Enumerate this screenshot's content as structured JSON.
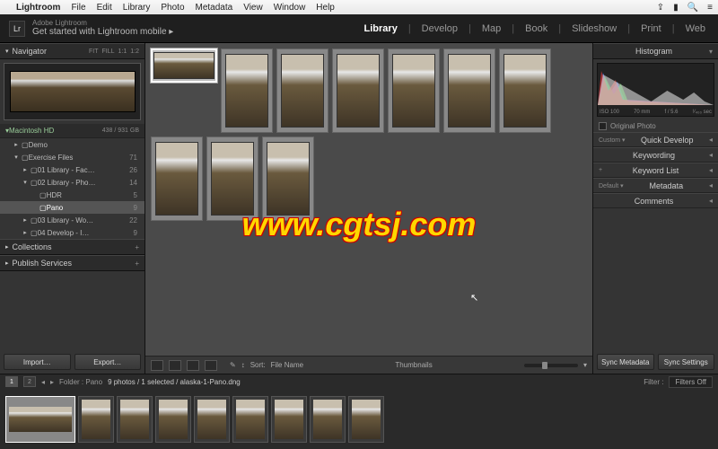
{
  "menubar": {
    "app": "Lightroom",
    "items": [
      "File",
      "Edit",
      "Library",
      "Photo",
      "Metadata",
      "View",
      "Window",
      "Help"
    ]
  },
  "brand": {
    "sub": "Adobe Lightroom",
    "title": "Get started with Lightroom mobile ▸"
  },
  "modules": [
    "Library",
    "Develop",
    "Map",
    "Book",
    "Slideshow",
    "Print",
    "Web"
  ],
  "active_module": "Library",
  "navigator": {
    "label": "Navigator",
    "opts": [
      "FIT",
      "FILL",
      "1:1",
      "1:2"
    ]
  },
  "volume": {
    "name": "Macintosh HD",
    "stat": "438 / 931 GB"
  },
  "tree": [
    {
      "ind": 1,
      "icon": "▸",
      "name": "Demo",
      "ct": ""
    },
    {
      "ind": 1,
      "icon": "▾",
      "name": "Exercise Files",
      "ct": "71"
    },
    {
      "ind": 2,
      "icon": "▸",
      "name": "01 Library - Fac…",
      "ct": "26"
    },
    {
      "ind": 2,
      "icon": "▾",
      "name": "02 Library - Pho…",
      "ct": "14"
    },
    {
      "ind": 3,
      "icon": "",
      "name": "HDR",
      "ct": "5"
    },
    {
      "ind": 3,
      "icon": "",
      "name": "Pano",
      "ct": "9",
      "sel": true
    },
    {
      "ind": 2,
      "icon": "▸",
      "name": "03 Library - Wo…",
      "ct": "22"
    },
    {
      "ind": 2,
      "icon": "▸",
      "name": "04 Develop - I…",
      "ct": "9"
    }
  ],
  "left_sections": [
    "Collections",
    "Publish Services"
  ],
  "left_buttons": {
    "import": "Import…",
    "export": "Export…"
  },
  "right_panels": {
    "histogram": "Histogram",
    "histo_info": [
      "ISO 100",
      "70 mm",
      "f / 5.6",
      "¹⁄₄₀₀ sec"
    ],
    "orig": "Original Photo",
    "rows": [
      {
        "pre": "Custom ▾",
        "label": "Quick Develop"
      },
      {
        "pre": "",
        "label": "Keywording"
      },
      {
        "pre": "+",
        "label": "Keyword List"
      },
      {
        "pre": "Default ▾",
        "label": "Metadata"
      },
      {
        "pre": "",
        "label": "Comments"
      }
    ],
    "sync_meta": "Sync Metadata",
    "sync_set": "Sync Settings"
  },
  "toolbar": {
    "sort_lbl": "Sort:",
    "sort_val": "File Name",
    "thumb_lbl": "Thumbnails"
  },
  "filmstrip": {
    "pages": [
      "1",
      "2"
    ],
    "crumb": "Folder : Pano",
    "info": "9 photos / 1 selected / alaska-1-Pano.dng",
    "filter_lbl": "Filter :",
    "filter_val": "Filters Off"
  },
  "watermark": "www.cgtsj.com"
}
